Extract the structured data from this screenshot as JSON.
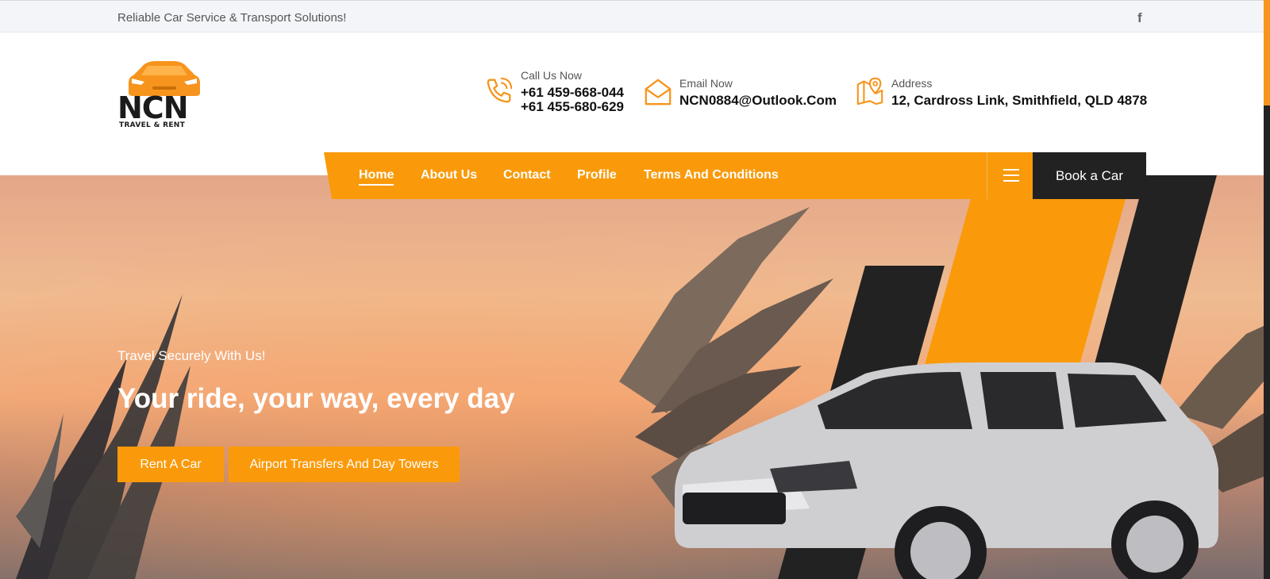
{
  "topbar": {
    "tagline": "Reliable Car Service & Transport Solutions!",
    "facebook_glyph": "f"
  },
  "logo": {
    "name": "NCN",
    "subtitle": "TRAVEL & RENT"
  },
  "contact": {
    "call_label": "Call Us Now",
    "phone_1": "+61 459-668-044",
    "phone_2": "+61 455-680-629",
    "email_label": "Email Now",
    "email": "NCN0884@Outlook.Com",
    "address_label": "Address",
    "address": "12, Cardross Link, Smithfield, QLD 4878"
  },
  "nav": {
    "items": [
      {
        "label": "Home",
        "active": true
      },
      {
        "label": "About Us"
      },
      {
        "label": "Contact"
      },
      {
        "label": "Profile"
      },
      {
        "label": "Terms And Conditions"
      }
    ],
    "book_label": "Book a Car"
  },
  "hero": {
    "kicker": "Travel Securely With Us!",
    "headline": "Your ride, your way, every day",
    "button_1": "Rent A Car",
    "button_2": "Airport Transfers And Day Towers"
  },
  "colors": {
    "accent": "#fa9a0a",
    "dark": "#222222"
  },
  "icons": {
    "phone": "phone-icon",
    "email": "envelope-icon",
    "address": "map-pin-icon",
    "menu": "hamburger-icon",
    "facebook": "facebook-icon"
  }
}
